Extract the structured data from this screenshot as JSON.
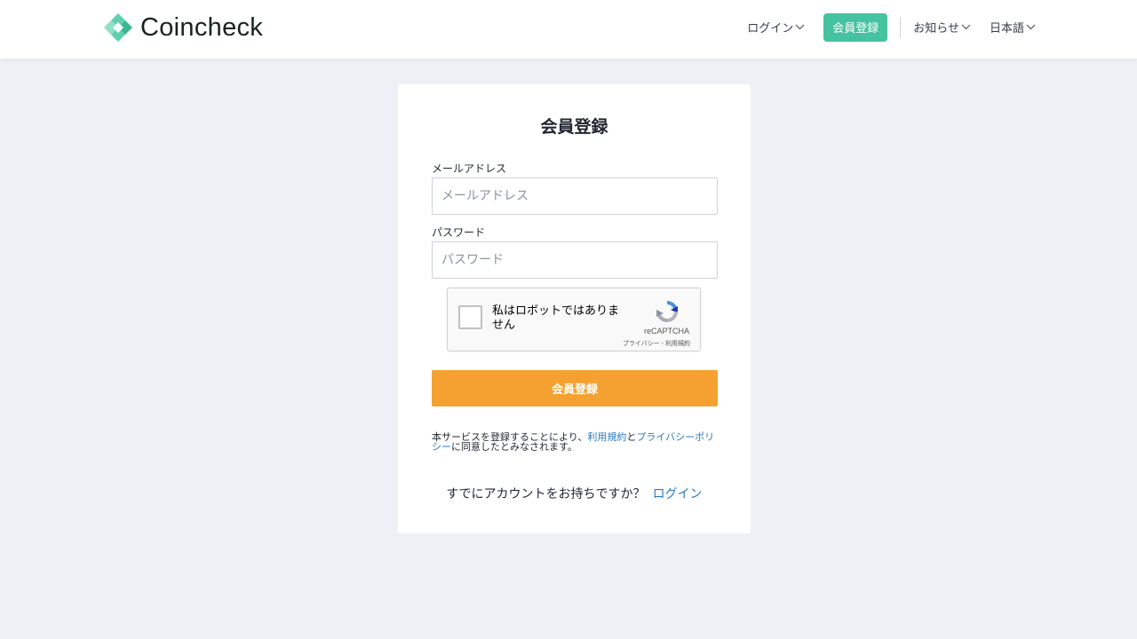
{
  "header": {
    "logo_text": "Coincheck",
    "nav": {
      "login_label": "ログイン",
      "signup_label": "会員登録",
      "news_label": "お知らせ",
      "language_label": "日本語"
    },
    "brand_color": "#45c2a0"
  },
  "form": {
    "title": "会員登録",
    "email": {
      "label": "メールアドレス",
      "placeholder": "メールアドレス",
      "value": ""
    },
    "password": {
      "label": "パスワード",
      "placeholder": "パスワード",
      "value": ""
    },
    "recaptcha": {
      "checkbox_text": "私はロボットではありません",
      "brand": "reCAPTCHA",
      "privacy_link": "プライバシー",
      "separator": " - ",
      "terms_link": "利用規約",
      "checked": false
    },
    "submit_label": "会員登録",
    "submit_color": "#f5a132",
    "terms": {
      "prefix": "本サービスを登録することにより、",
      "terms_link": "利用規約",
      "middle": "と",
      "privacy_link": "プライバシーポリシー",
      "suffix": "に同意したとみなされます。"
    },
    "already": {
      "question": "すでにアカウントをお持ちですか？",
      "login_link": "ログイン"
    }
  },
  "icons": [
    "coincheck-logo-icon",
    "chevron-down-icon",
    "recaptcha-logo-icon"
  ]
}
